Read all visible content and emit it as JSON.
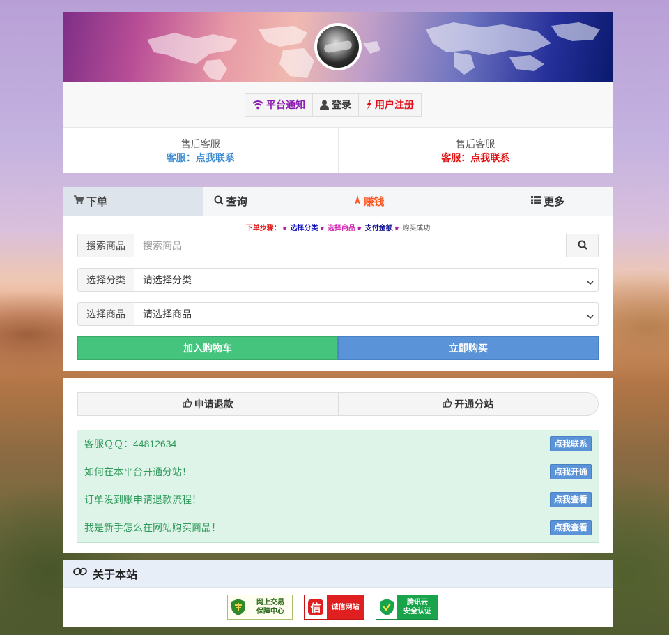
{
  "header": {
    "nav": [
      {
        "label": "平台通知",
        "icon": "wifi-icon"
      },
      {
        "label": "登录",
        "icon": "user-icon"
      },
      {
        "label": "用户注册",
        "icon": "bolt-icon"
      }
    ],
    "service": [
      {
        "title": "售后客服",
        "link": "客服：点我联系"
      },
      {
        "title": "售后客服",
        "link": "客服：点我联系"
      }
    ]
  },
  "order": {
    "tabs": [
      {
        "label": "下单",
        "icon": "cart-icon"
      },
      {
        "label": "查询",
        "icon": "search-icon"
      },
      {
        "label": "赚钱",
        "icon": "rocket-icon"
      },
      {
        "label": "更多",
        "icon": "list-icon"
      }
    ],
    "steps": {
      "prefix": "下单步骤：",
      "s1": "选择分类",
      "s2": "选择商品",
      "s3": "支付金额",
      "s4": "购买成功",
      "arrow": "☛"
    },
    "search_label": "搜索商品",
    "search_placeholder": "搜索商品",
    "category_label": "选择分类",
    "category_value": "请选择分类",
    "product_label": "选择商品",
    "product_value": "请选择商品",
    "cart_button": "加入购物车",
    "buy_button": "立即购买"
  },
  "service": {
    "pills": [
      {
        "label": "申请退款",
        "icon": "thumbs-up-icon"
      },
      {
        "label": "开通分站",
        "icon": "thumbs-up-icon"
      }
    ],
    "notices": [
      {
        "text": "客服ＱＱ：44812634",
        "button": "点我联系"
      },
      {
        "text": "如何在本平台开通分站！",
        "button": "点我开通"
      },
      {
        "text": "订单没到账申请退款流程！",
        "button": "点我查看"
      },
      {
        "text": "我是新手怎么在网站购买商品！",
        "button": "点我查看"
      }
    ]
  },
  "about": {
    "title": "关于本站",
    "badges": [
      {
        "line1": "网上交易",
        "line2": "保障中心"
      },
      {
        "line1": "诚信网站",
        "line2": ""
      },
      {
        "line1": "腾讯云",
        "line2": "安全认证"
      }
    ]
  },
  "colors": {
    "green_button": "#44c47c",
    "blue_button": "#5b93d8",
    "notice_bg": "#dff4e8",
    "notice_text": "#2e9a5a",
    "register_red": "#e0101a",
    "notice_purple": "#8b1bb0",
    "earn_orange": "#ff5722"
  }
}
